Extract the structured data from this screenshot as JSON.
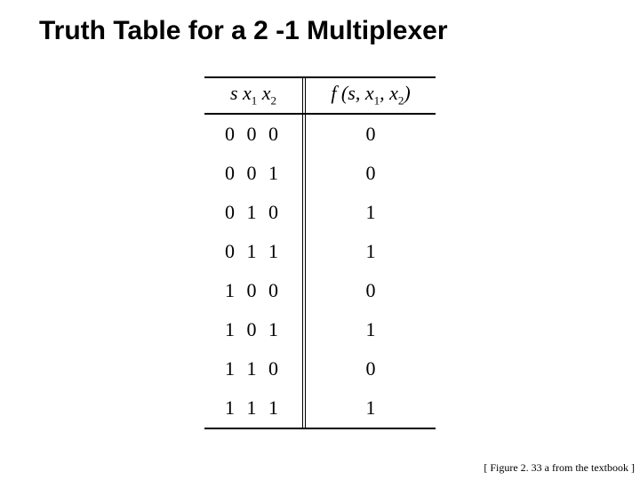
{
  "title": "Truth Table for a 2 -1 Multiplexer",
  "header": {
    "input_vars": "s x",
    "input_sub1": "1",
    "input_mid": " x",
    "input_sub2": "2",
    "output_fn": "f (s, x",
    "output_sub1": "1",
    "output_mid": ", x",
    "output_sub2": "2",
    "output_close": ")"
  },
  "chart_data": {
    "type": "table",
    "columns": [
      "s x1 x2",
      "f(s, x1, x2)"
    ],
    "rows": [
      {
        "inputs": "0 0 0",
        "output": "0"
      },
      {
        "inputs": "0 0 1",
        "output": "0"
      },
      {
        "inputs": "0 1 0",
        "output": "1"
      },
      {
        "inputs": "0 1 1",
        "output": "1"
      },
      {
        "inputs": "1 0 0",
        "output": "0"
      },
      {
        "inputs": "1 0 1",
        "output": "1"
      },
      {
        "inputs": "1 1 0",
        "output": "0"
      },
      {
        "inputs": "1 1 1",
        "output": "1"
      }
    ]
  },
  "caption": "[ Figure 2. 33 a from the textbook ]"
}
